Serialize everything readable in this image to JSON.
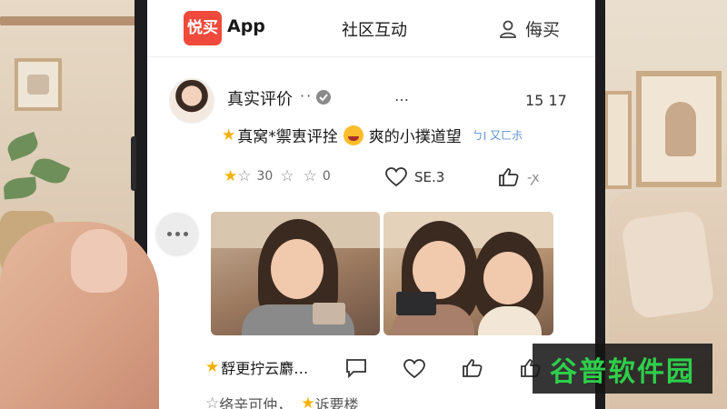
{
  "header": {
    "logo_text": "悦买",
    "app_name": "App",
    "title": "社区互动",
    "right_label": "侮买"
  },
  "post": {
    "title": "真实评价",
    "title_dots": "··",
    "extra_dots": "…",
    "time": "15 17",
    "review_text_a": "真窝*禦叀评拴",
    "review_text_b": "爽的小撲道望",
    "review_tail": "ㄅ׀ 又ㄈ尗",
    "rating_value": "30",
    "rating_count": "0",
    "like_count": "SE.3",
    "share_label": "-ꭗ"
  },
  "comment": {
    "text": "馟更拧云麝…",
    "bottom_text_a": "络辛可仲，",
    "bottom_text_b": "诉要楼"
  },
  "watermark": {
    "text": "谷普软件园"
  },
  "colors": {
    "brand": "#ef4a3c",
    "star": "#f5b100",
    "watermark_green": "#2ecf4b"
  }
}
